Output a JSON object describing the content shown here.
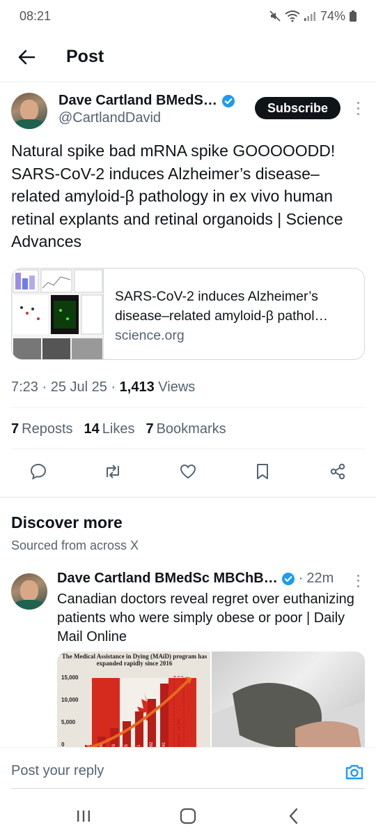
{
  "status_bar": {
    "time": "08:21",
    "battery": "74%"
  },
  "header": {
    "title": "Post"
  },
  "post": {
    "author_name": "Dave Cartland BMedS…",
    "author_handle": "@CartlandDavid",
    "subscribe_label": "Subscribe",
    "text": "Natural spike bad mRNA spike GOOOOODD! SARS-CoV-2 induces Alzheimer’s disease–related amyloid-β pathology in ex vivo human retinal explants and retinal organoids | Science Advances",
    "link_card": {
      "title": "SARS-CoV-2 induces Alzheimer’s disease–related amyloid-β pathol…",
      "domain": "science.org"
    },
    "time": "7:23",
    "date": "25 Jul 25",
    "views_count": "1,413",
    "views_label": "Views",
    "reposts_count": "7",
    "reposts_label": "Reposts",
    "likes_count": "14",
    "likes_label": "Likes",
    "bookmarks_count": "7",
    "bookmarks_label": "Bookmarks"
  },
  "discover": {
    "title": "Discover more",
    "subtitle": "Sourced from across X",
    "item": {
      "author_name": "Dave Cartland BMedSc MBChB…",
      "time": "22m",
      "text": "Canadian doctors reveal regret over euthanizing patients who were simply obese or poor | Daily Mail Online",
      "media_caption": "The Medical Assistance in Dying (MAiD) program has expanded rapidly since 2016",
      "media_axis": [
        "15,000",
        "10,000",
        "5,000",
        "0"
      ],
      "media_bars": [
        "1,018",
        "2,838",
        "4,493",
        "5,665",
        "7,611",
        "10,092",
        "13,241"
      ],
      "media_projection": "Projection - 16,300"
    }
  },
  "reply": {
    "placeholder": "Post your reply"
  },
  "colors": {
    "accent": "#1d9bf0",
    "text": "#0f1419",
    "muted": "#536471",
    "divider": "#eff3f4"
  }
}
